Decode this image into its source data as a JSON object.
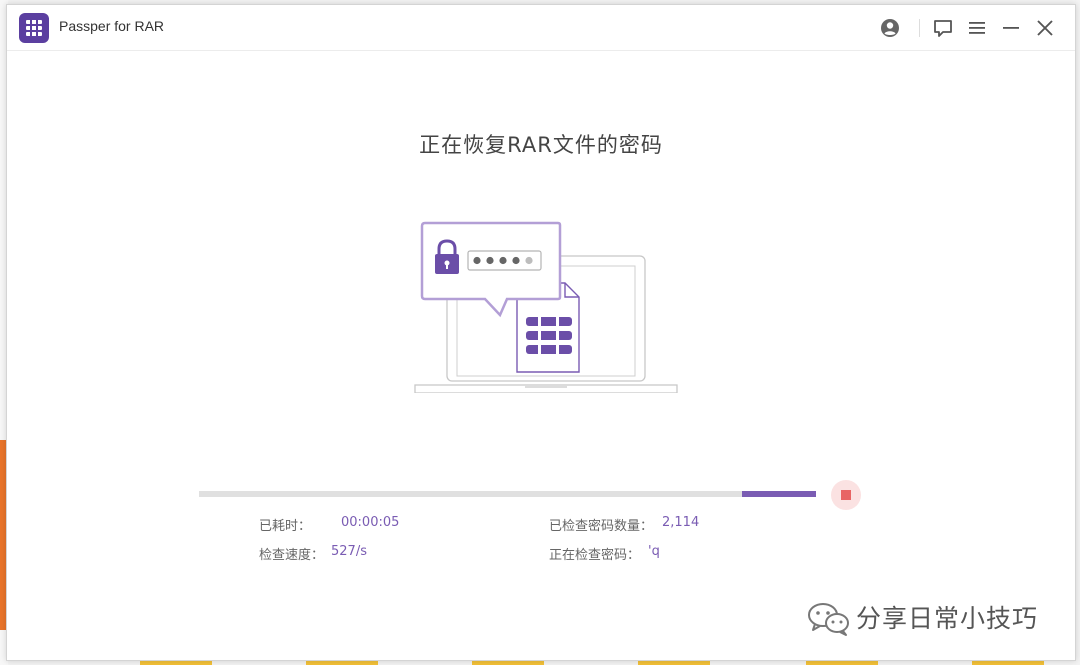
{
  "app": {
    "title": "Passper for RAR"
  },
  "titlebar": {
    "icons": [
      "account-icon",
      "feedback-icon",
      "menu-icon",
      "minimize-icon",
      "close-icon"
    ]
  },
  "main": {
    "heading": "正在恢复RAR文件的密码",
    "progress_percent": 12,
    "stats": {
      "elapsed_label": "已耗时：",
      "elapsed_value": "00:00:05",
      "speed_label": "检查速度：",
      "speed_value": "527/s",
      "checked_label": "已检查密码数量：",
      "checked_value": "2,114",
      "current_label": "正在检查密码：",
      "current_value": "'q"
    }
  },
  "watermark": {
    "text": "分享日常小技巧"
  },
  "colors": {
    "accent": "#7a5cb3",
    "brand": "#5b3fa0",
    "stop": "#e86464"
  }
}
